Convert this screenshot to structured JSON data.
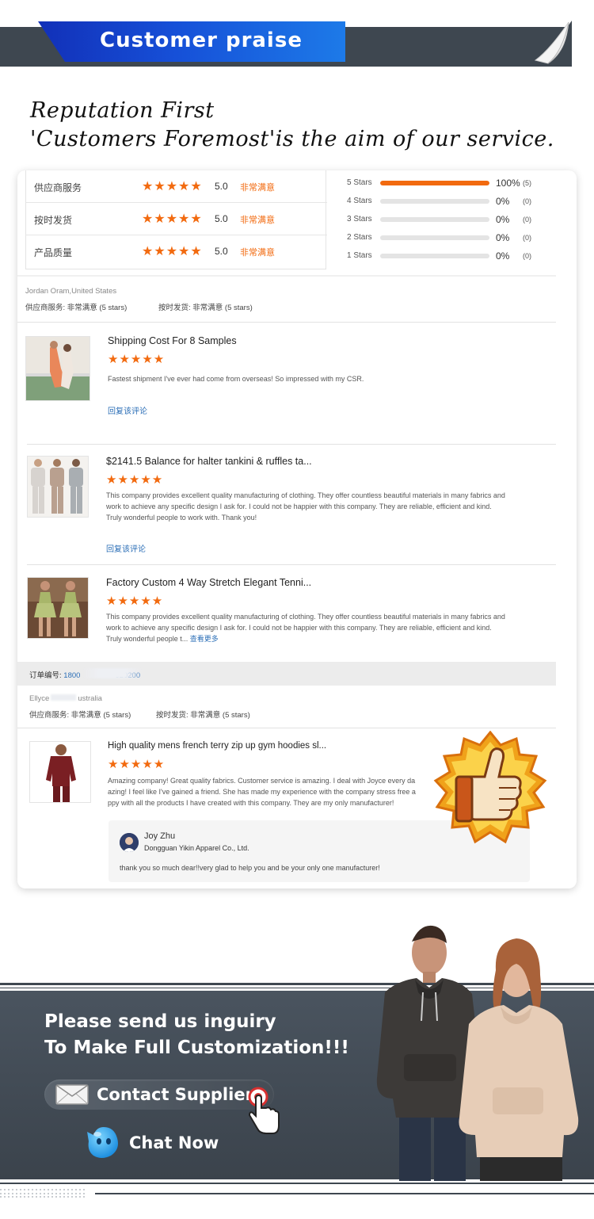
{
  "header": {
    "title": "Customer praise"
  },
  "slogan": {
    "line1": "Reputation First",
    "line2": "'Customers Foremost'is the aim of our service."
  },
  "ratings": [
    {
      "label": "供应商服务",
      "stars": "★★★★★",
      "score": "5.0",
      "level": "非常满意"
    },
    {
      "label": "按时发货",
      "stars": "★★★★★",
      "score": "5.0",
      "level": "非常满意"
    },
    {
      "label": "产品质量",
      "stars": "★★★★★",
      "score": "5.0",
      "level": "非常满意"
    }
  ],
  "distribution": [
    {
      "label": "5 Stars",
      "fraction": 1.0,
      "pct": "100%",
      "count": "(5)"
    },
    {
      "label": "4 Stars",
      "fraction": 0,
      "pct": "0%",
      "count": "(0)"
    },
    {
      "label": "3 Stars",
      "fraction": 0,
      "pct": "0%",
      "count": "(0)"
    },
    {
      "label": "2 Stars",
      "fraction": 0,
      "pct": "0%",
      "count": "(0)"
    },
    {
      "label": "1 Stars",
      "fraction": 0,
      "pct": "0%",
      "count": "(0)"
    }
  ],
  "review_group1": {
    "name": "Jordan Oram,United States",
    "supplier_service": "供应商服务: 非常满意  (5 stars)",
    "on_time": "按时发货: 非常满意  (5 stars)"
  },
  "reviews": [
    {
      "title": "Shipping Cost For 8 Samples",
      "stars": "★★★★★",
      "body": "Fastest shipment I've ever had come from overseas! So impressed with my CSR.",
      "reply_link": "回复该评论"
    },
    {
      "title": "$2141.5 Balance for halter tankini & ruffles ta...",
      "stars": "★★★★★",
      "body": "This company provides excellent quality manufacturing of clothing. They offer countless beautiful materials in many fabrics and work to achieve any specific design I ask for. I could not be happier with this company. They are reliable, efficient and kind. Truly wonderful people to work with. Thank you!",
      "reply_link": "回复该评论"
    },
    {
      "title": "Factory Custom 4 Way Stretch Elegant Tenni...",
      "stars": "★★★★★",
      "body": "This company provides excellent quality manufacturing of clothing. They offer countless beautiful materials in many fabrics and work to achieve any specific design I ask for. I could not be happier with this company. They are reliable, efficient and kind. Truly wonderful people t...",
      "more": "查看更多"
    }
  ],
  "order": {
    "label": "订单编号:",
    "number_start": "1800",
    "number_end": "620200"
  },
  "review_group2": {
    "name_start": "Ellyce",
    "name_end": "ustralia",
    "supplier_service": "供应商服务: 非常满意  (5 stars)",
    "on_time": "按时发货: 非常满意  (5 stars)"
  },
  "review4": {
    "title": "High quality mens french terry zip up gym hoodies sl...",
    "stars": "★★★★★",
    "line1": "Amazing company! Great quality fabrics. Customer service is amazing. I deal with Joyce every da",
    "line2": "azing! I feel like I've gained a friend. She has made my experience with the company stress free a",
    "line3": "ppy with all the products I have created with this company. They are my only manufacturer!"
  },
  "reply": {
    "name": "Joy Zhu",
    "company": "Dongguan Yikin Apparel Co., Ltd.",
    "message": "thank you so much dear!!very glad to help you and be your only one manufacturer!"
  },
  "cta": {
    "line1": "Please send us inguiry",
    "line2": "To Make Full Customization!!!",
    "contact": "Contact Supplier",
    "chat": "Chat Now"
  },
  "colors": {
    "accent": "#f26a0f",
    "link": "#2c6fb7",
    "banner_blue": "#1650d8",
    "panel": "#3e4750"
  }
}
